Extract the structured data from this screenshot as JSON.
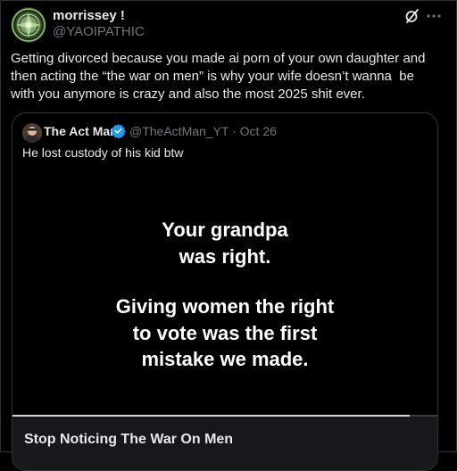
{
  "post": {
    "display_name": "morrissey !",
    "handle": "@YAOIPATHIC",
    "avatar_icon": "avatar-icon",
    "grok_icon": "grok-icon",
    "more_icon": "more-icon",
    "text": "Getting divorced because you made ai porn of your own daughter and then acting the “the war on men” is why your wife doesn’t wanna  be with you anymore is crazy and also the most 2025 shit ever."
  },
  "quote": {
    "display_name": "The Act Man",
    "verified_icon": "verified-icon",
    "handle_date": "@TheActMan_YT · Oct 26",
    "text": "He lost custody of his kid btw",
    "video_lines": [
      "Your grandpa",
      "was right.",
      "",
      "Giving women the right",
      "to vote was the first",
      "mistake we made."
    ],
    "progress_fraction": 0.935,
    "card_title": "Stop Noticing The War On Men"
  },
  "colors": {
    "background": "#000000",
    "text_primary": "#e7e9ea",
    "text_secondary": "#71767b",
    "border": "#2f3336",
    "verified_blue": "#1d9bf0",
    "card_footer": "#16181c"
  }
}
